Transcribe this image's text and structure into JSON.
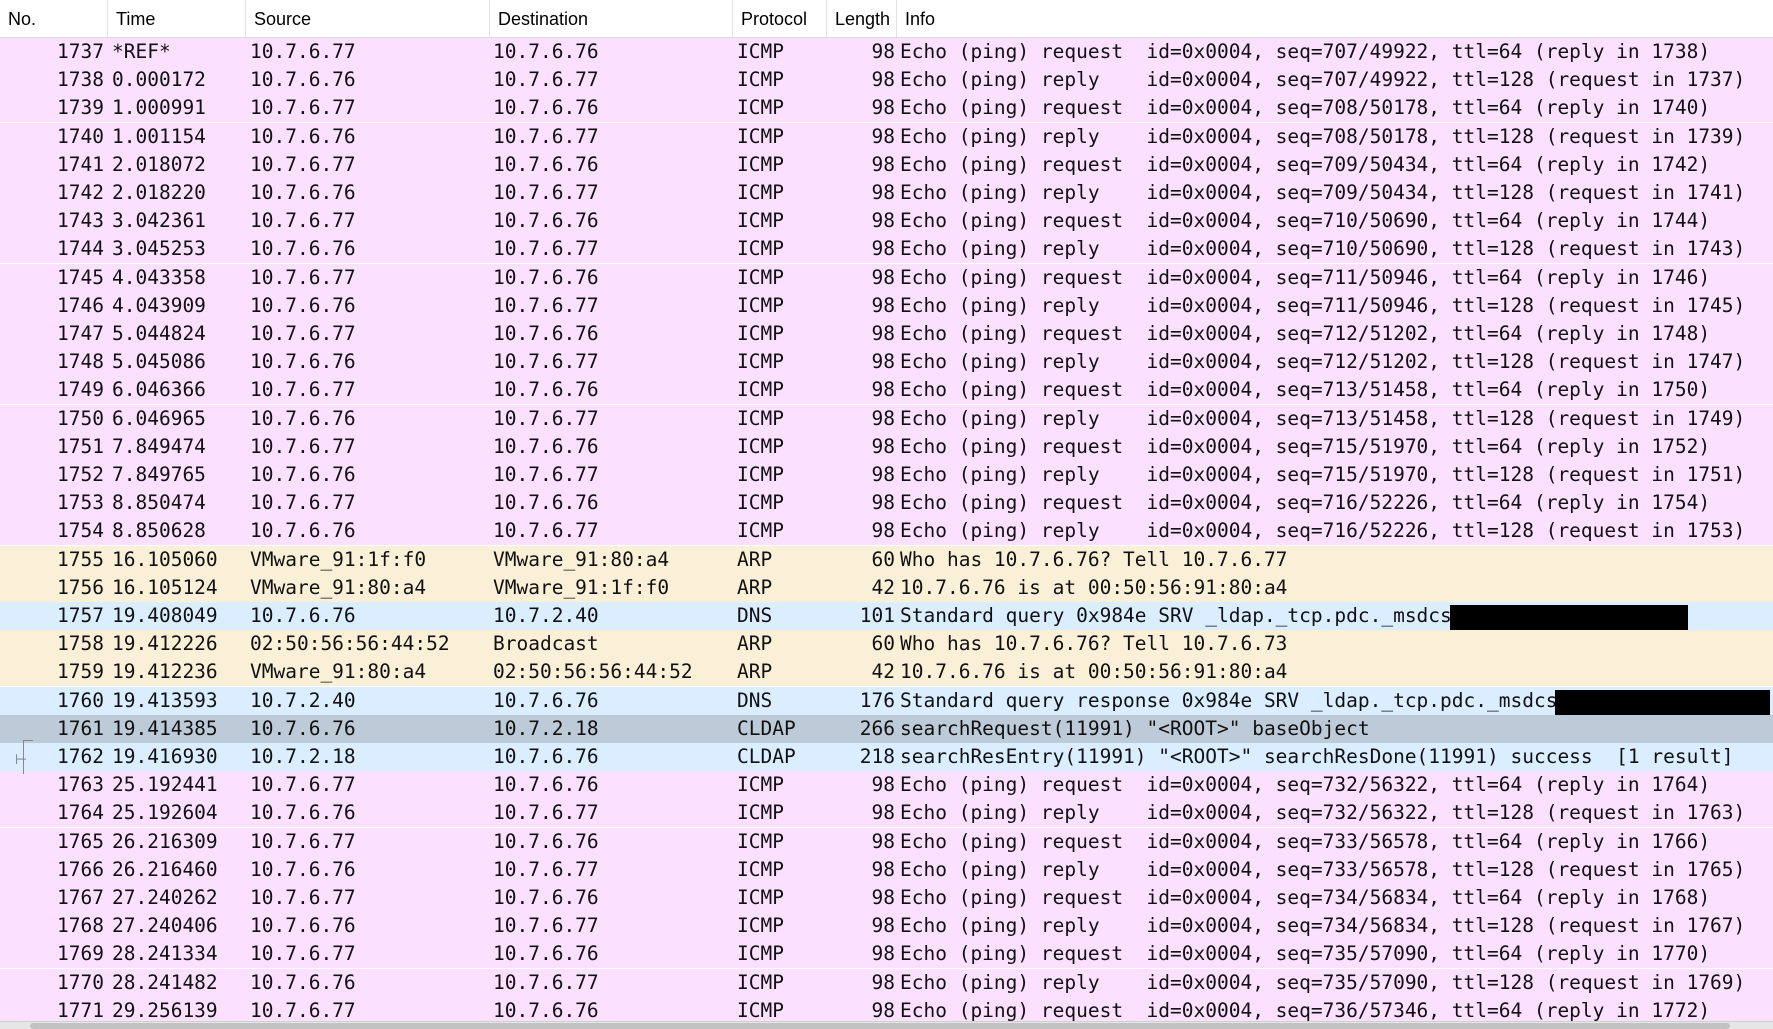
{
  "columns": {
    "no": "No.",
    "time": "Time",
    "source": "Source",
    "destination": "Destination",
    "protocol": "Protocol",
    "length": "Length",
    "info": "Info"
  },
  "colors": {
    "icmp": "#fce0ff",
    "arp": "#faf0d7",
    "dns": "#daeeff",
    "cldap_selected": "#bdcad8",
    "cldap": "#daeeff",
    "redaction": "#000000"
  },
  "icons": {
    "conversation": "related-packet-arrow-icon"
  },
  "packets": [
    {
      "no": "1737",
      "time": "*REF*",
      "source": "10.7.6.77",
      "destination": "10.7.6.76",
      "protocol": "ICMP",
      "length": "98",
      "info": "Echo (ping) request  id=0x0004, seq=707/49922, ttl=64 (reply in 1738)",
      "type": "icmp"
    },
    {
      "no": "1738",
      "time": "0.000172",
      "source": "10.7.6.76",
      "destination": "10.7.6.77",
      "protocol": "ICMP",
      "length": "98",
      "info": "Echo (ping) reply    id=0x0004, seq=707/49922, ttl=128 (request in 1737)",
      "type": "icmp"
    },
    {
      "no": "1739",
      "time": "1.000991",
      "source": "10.7.6.77",
      "destination": "10.7.6.76",
      "protocol": "ICMP",
      "length": "98",
      "info": "Echo (ping) request  id=0x0004, seq=708/50178, ttl=64 (reply in 1740)",
      "type": "icmp"
    },
    {
      "no": "1740",
      "time": "1.001154",
      "source": "10.7.6.76",
      "destination": "10.7.6.77",
      "protocol": "ICMP",
      "length": "98",
      "info": "Echo (ping) reply    id=0x0004, seq=708/50178, ttl=128 (request in 1739)",
      "type": "icmp"
    },
    {
      "no": "1741",
      "time": "2.018072",
      "source": "10.7.6.77",
      "destination": "10.7.6.76",
      "protocol": "ICMP",
      "length": "98",
      "info": "Echo (ping) request  id=0x0004, seq=709/50434, ttl=64 (reply in 1742)",
      "type": "icmp"
    },
    {
      "no": "1742",
      "time": "2.018220",
      "source": "10.7.6.76",
      "destination": "10.7.6.77",
      "protocol": "ICMP",
      "length": "98",
      "info": "Echo (ping) reply    id=0x0004, seq=709/50434, ttl=128 (request in 1741)",
      "type": "icmp"
    },
    {
      "no": "1743",
      "time": "3.042361",
      "source": "10.7.6.77",
      "destination": "10.7.6.76",
      "protocol": "ICMP",
      "length": "98",
      "info": "Echo (ping) request  id=0x0004, seq=710/50690, ttl=64 (reply in 1744)",
      "type": "icmp"
    },
    {
      "no": "1744",
      "time": "3.045253",
      "source": "10.7.6.76",
      "destination": "10.7.6.77",
      "protocol": "ICMP",
      "length": "98",
      "info": "Echo (ping) reply    id=0x0004, seq=710/50690, ttl=128 (request in 1743)",
      "type": "icmp"
    },
    {
      "no": "1745",
      "time": "4.043358",
      "source": "10.7.6.77",
      "destination": "10.7.6.76",
      "protocol": "ICMP",
      "length": "98",
      "info": "Echo (ping) request  id=0x0004, seq=711/50946, ttl=64 (reply in 1746)",
      "type": "icmp"
    },
    {
      "no": "1746",
      "time": "4.043909",
      "source": "10.7.6.76",
      "destination": "10.7.6.77",
      "protocol": "ICMP",
      "length": "98",
      "info": "Echo (ping) reply    id=0x0004, seq=711/50946, ttl=128 (request in 1745)",
      "type": "icmp"
    },
    {
      "no": "1747",
      "time": "5.044824",
      "source": "10.7.6.77",
      "destination": "10.7.6.76",
      "protocol": "ICMP",
      "length": "98",
      "info": "Echo (ping) request  id=0x0004, seq=712/51202, ttl=64 (reply in 1748)",
      "type": "icmp"
    },
    {
      "no": "1748",
      "time": "5.045086",
      "source": "10.7.6.76",
      "destination": "10.7.6.77",
      "protocol": "ICMP",
      "length": "98",
      "info": "Echo (ping) reply    id=0x0004, seq=712/51202, ttl=128 (request in 1747)",
      "type": "icmp"
    },
    {
      "no": "1749",
      "time": "6.046366",
      "source": "10.7.6.77",
      "destination": "10.7.6.76",
      "protocol": "ICMP",
      "length": "98",
      "info": "Echo (ping) request  id=0x0004, seq=713/51458, ttl=64 (reply in 1750)",
      "type": "icmp"
    },
    {
      "no": "1750",
      "time": "6.046965",
      "source": "10.7.6.76",
      "destination": "10.7.6.77",
      "protocol": "ICMP",
      "length": "98",
      "info": "Echo (ping) reply    id=0x0004, seq=713/51458, ttl=128 (request in 1749)",
      "type": "icmp"
    },
    {
      "no": "1751",
      "time": "7.849474",
      "source": "10.7.6.77",
      "destination": "10.7.6.76",
      "protocol": "ICMP",
      "length": "98",
      "info": "Echo (ping) request  id=0x0004, seq=715/51970, ttl=64 (reply in 1752)",
      "type": "icmp"
    },
    {
      "no": "1752",
      "time": "7.849765",
      "source": "10.7.6.76",
      "destination": "10.7.6.77",
      "protocol": "ICMP",
      "length": "98",
      "info": "Echo (ping) reply    id=0x0004, seq=715/51970, ttl=128 (request in 1751)",
      "type": "icmp"
    },
    {
      "no": "1753",
      "time": "8.850474",
      "source": "10.7.6.77",
      "destination": "10.7.6.76",
      "protocol": "ICMP",
      "length": "98",
      "info": "Echo (ping) request  id=0x0004, seq=716/52226, ttl=64 (reply in 1754)",
      "type": "icmp"
    },
    {
      "no": "1754",
      "time": "8.850628",
      "source": "10.7.6.76",
      "destination": "10.7.6.77",
      "protocol": "ICMP",
      "length": "98",
      "info": "Echo (ping) reply    id=0x0004, seq=716/52226, ttl=128 (request in 1753)",
      "type": "icmp"
    },
    {
      "no": "1755",
      "time": "16.105060",
      "source": "VMware_91:1f:f0",
      "destination": "VMware_91:80:a4",
      "protocol": "ARP",
      "length": "60",
      "info": "Who has 10.7.6.76? Tell 10.7.6.77",
      "type": "arp"
    },
    {
      "no": "1756",
      "time": "16.105124",
      "source": "VMware_91:80:a4",
      "destination": "VMware_91:1f:f0",
      "protocol": "ARP",
      "length": "42",
      "info": "10.7.6.76 is at 00:50:56:91:80:a4",
      "type": "arp"
    },
    {
      "no": "1757",
      "time": "19.408049",
      "source": "10.7.6.76",
      "destination": "10.7.2.40",
      "protocol": "DNS",
      "length": "101",
      "info": "Standard query 0x984e SRV _ldap._tcp.pdc._msdcs",
      "type": "dns",
      "redacted": true
    },
    {
      "no": "1758",
      "time": "19.412226",
      "source": "02:50:56:56:44:52",
      "destination": "Broadcast",
      "protocol": "ARP",
      "length": "60",
      "info": "Who has 10.7.6.76? Tell 10.7.6.73",
      "type": "arp"
    },
    {
      "no": "1759",
      "time": "19.412236",
      "source": "VMware_91:80:a4",
      "destination": "02:50:56:56:44:52",
      "protocol": "ARP",
      "length": "42",
      "info": "10.7.6.76 is at 00:50:56:91:80:a4",
      "type": "arp"
    },
    {
      "no": "1760",
      "time": "19.413593",
      "source": "10.7.2.40",
      "destination": "10.7.6.76",
      "protocol": "DNS",
      "length": "176",
      "info": "Standard query response 0x984e SRV _ldap._tcp.pdc._msdcs",
      "type": "dns",
      "redacted": true
    },
    {
      "no": "1761",
      "time": "19.414385",
      "source": "10.7.6.76",
      "destination": "10.7.2.18",
      "protocol": "CLDAP",
      "length": "266",
      "info": "searchRequest(11991) \"<ROOT>\" baseObject",
      "type": "cldap_selected"
    },
    {
      "no": "1762",
      "time": "19.416930",
      "source": "10.7.2.18",
      "destination": "10.7.6.76",
      "protocol": "CLDAP",
      "length": "218",
      "info": "searchResEntry(11991) \"<ROOT>\" searchResDone(11991) success  [1 result]",
      "type": "cldap"
    },
    {
      "no": "1763",
      "time": "25.192441",
      "source": "10.7.6.77",
      "destination": "10.7.6.76",
      "protocol": "ICMP",
      "length": "98",
      "info": "Echo (ping) request  id=0x0004, seq=732/56322, ttl=64 (reply in 1764)",
      "type": "icmp"
    },
    {
      "no": "1764",
      "time": "25.192604",
      "source": "10.7.6.76",
      "destination": "10.7.6.77",
      "protocol": "ICMP",
      "length": "98",
      "info": "Echo (ping) reply    id=0x0004, seq=732/56322, ttl=128 (request in 1763)",
      "type": "icmp"
    },
    {
      "no": "1765",
      "time": "26.216309",
      "source": "10.7.6.77",
      "destination": "10.7.6.76",
      "protocol": "ICMP",
      "length": "98",
      "info": "Echo (ping) request  id=0x0004, seq=733/56578, ttl=64 (reply in 1766)",
      "type": "icmp"
    },
    {
      "no": "1766",
      "time": "26.216460",
      "source": "10.7.6.76",
      "destination": "10.7.6.77",
      "protocol": "ICMP",
      "length": "98",
      "info": "Echo (ping) reply    id=0x0004, seq=733/56578, ttl=128 (request in 1765)",
      "type": "icmp"
    },
    {
      "no": "1767",
      "time": "27.240262",
      "source": "10.7.6.77",
      "destination": "10.7.6.76",
      "protocol": "ICMP",
      "length": "98",
      "info": "Echo (ping) request  id=0x0004, seq=734/56834, ttl=64 (reply in 1768)",
      "type": "icmp"
    },
    {
      "no": "1768",
      "time": "27.240406",
      "source": "10.7.6.76",
      "destination": "10.7.6.77",
      "protocol": "ICMP",
      "length": "98",
      "info": "Echo (ping) reply    id=0x0004, seq=734/56834, ttl=128 (request in 1767)",
      "type": "icmp"
    },
    {
      "no": "1769",
      "time": "28.241334",
      "source": "10.7.6.77",
      "destination": "10.7.6.76",
      "protocol": "ICMP",
      "length": "98",
      "info": "Echo (ping) request  id=0x0004, seq=735/57090, ttl=64 (reply in 1770)",
      "type": "icmp"
    },
    {
      "no": "1770",
      "time": "28.241482",
      "source": "10.7.6.76",
      "destination": "10.7.6.77",
      "protocol": "ICMP",
      "length": "98",
      "info": "Echo (ping) reply    id=0x0004, seq=735/57090, ttl=128 (request in 1769)",
      "type": "icmp"
    },
    {
      "no": "1771",
      "time": "29.256139",
      "source": "10.7.6.77",
      "destination": "10.7.6.76",
      "protocol": "ICMP",
      "length": "98",
      "info": "Echo (ping) request  id=0x0004, seq=736/57346, ttl=64 (reply in 1772)",
      "type": "icmp"
    }
  ]
}
